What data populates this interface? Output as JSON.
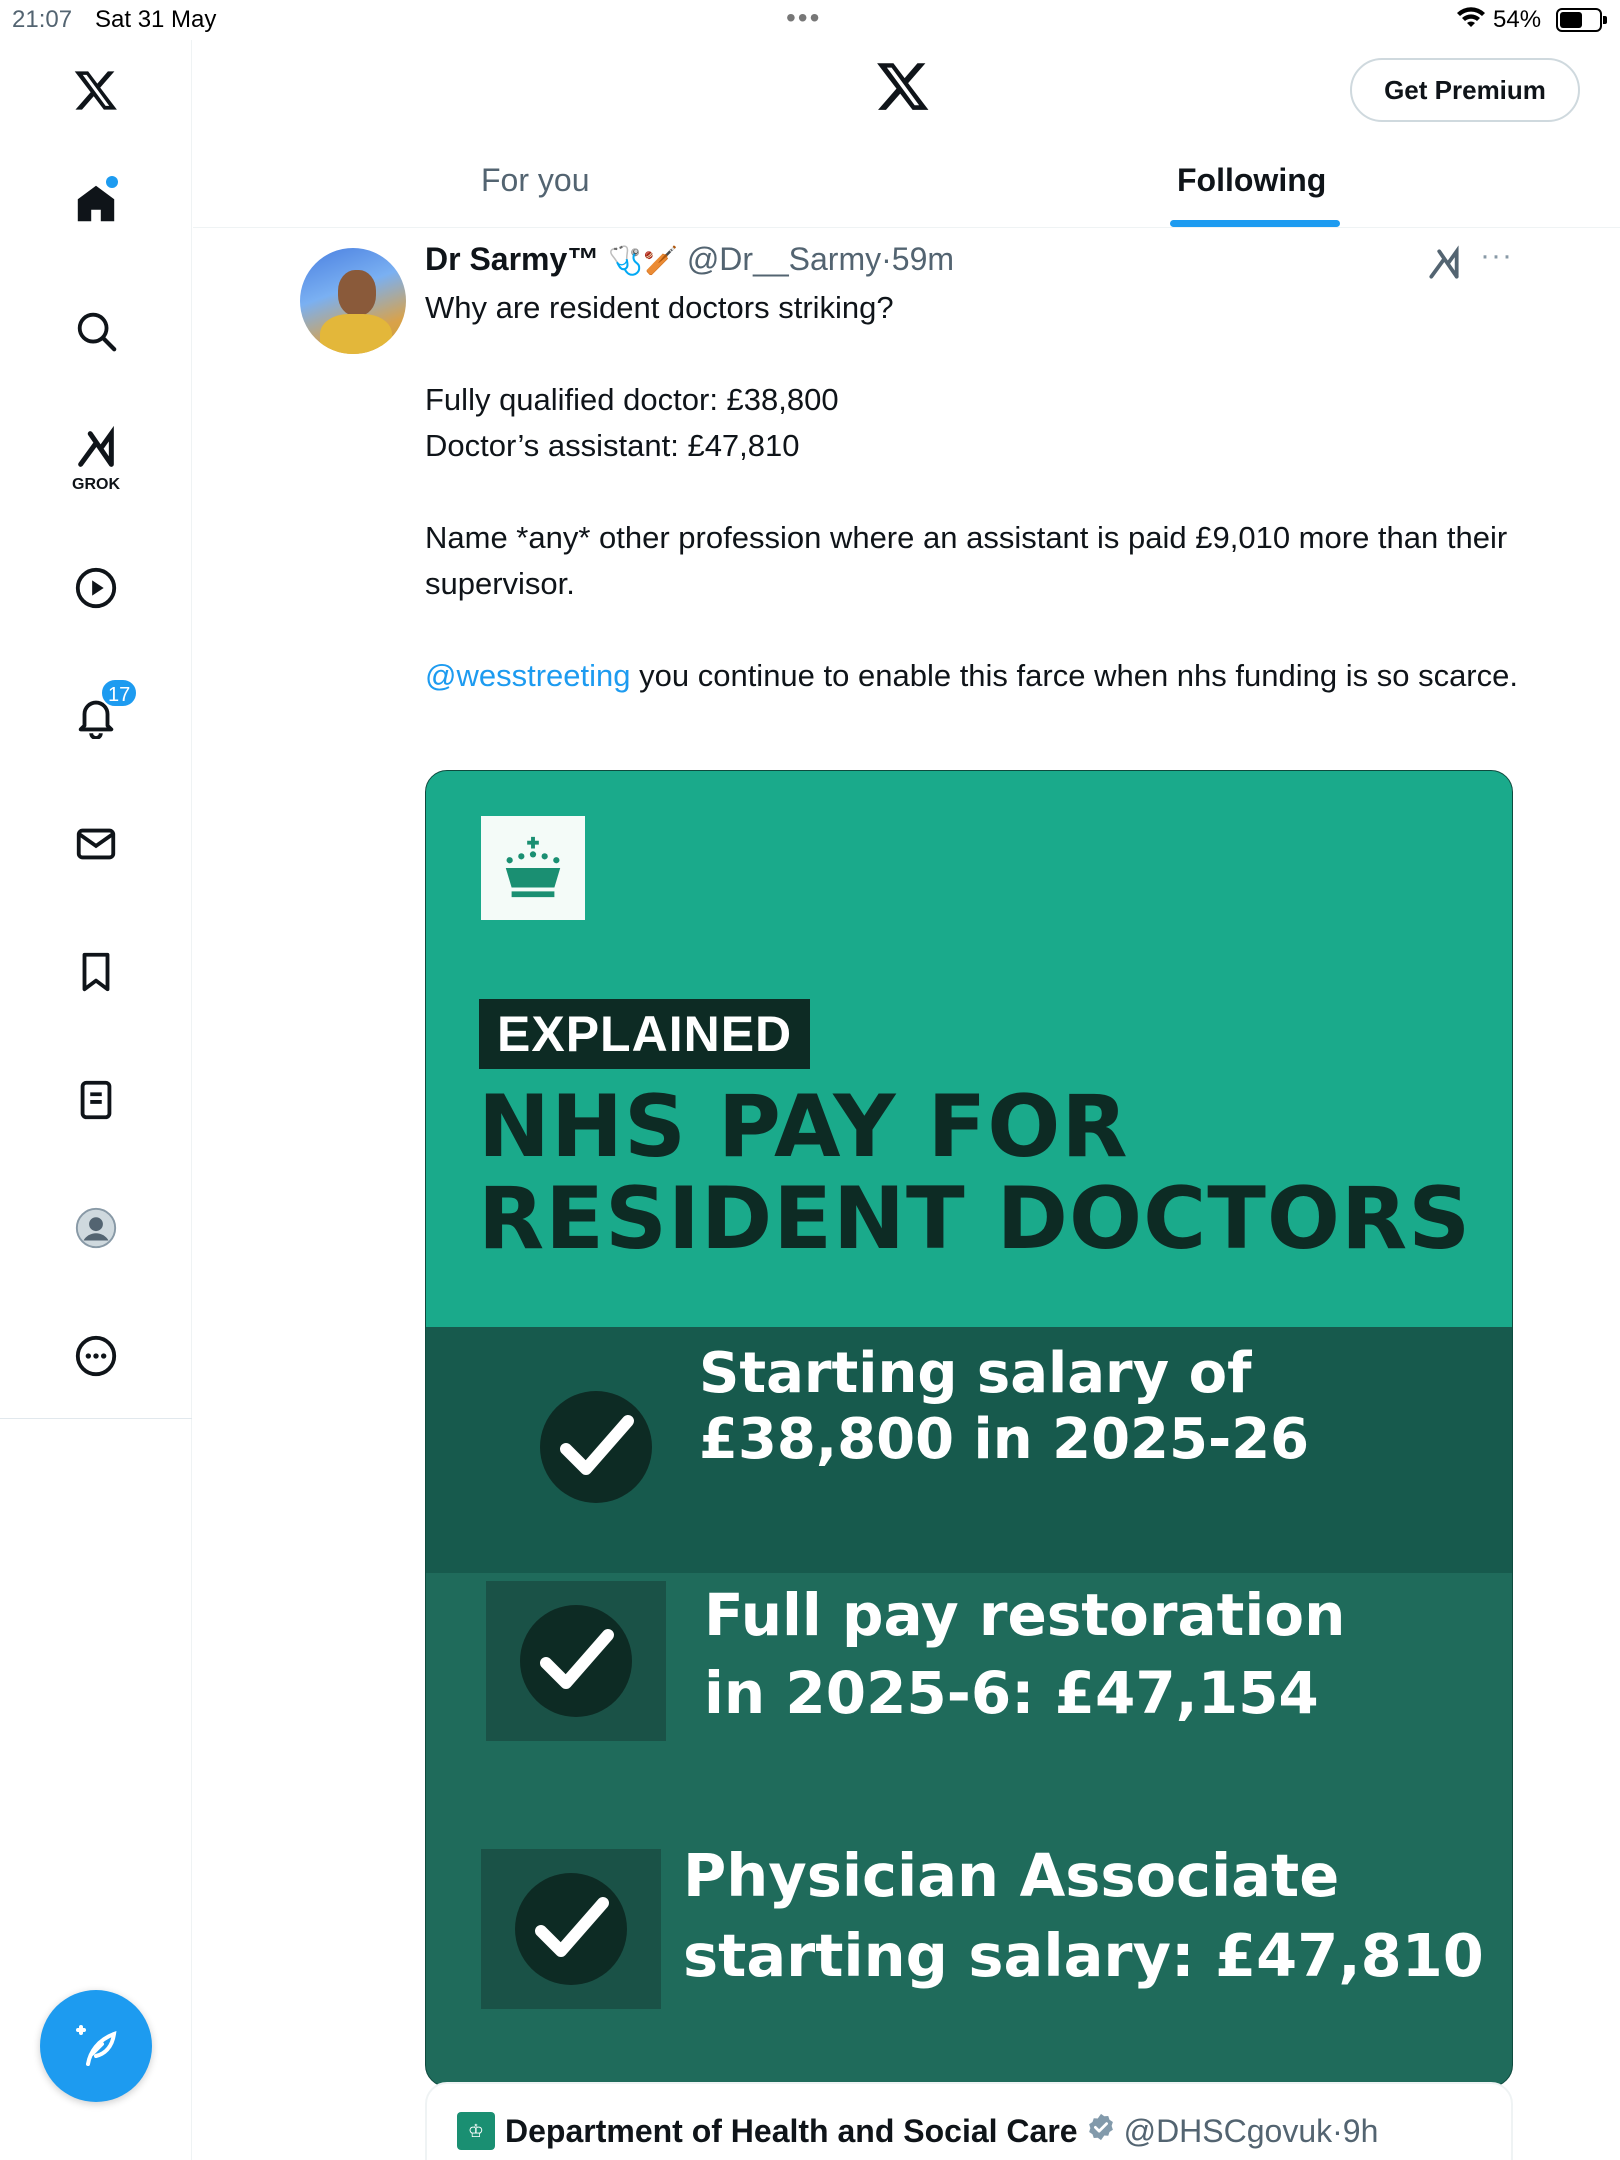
{
  "status_bar": {
    "time": "21:07",
    "date": "Sat 31 May",
    "battery": "54%",
    "dots": "•••"
  },
  "header": {
    "premium_label": "Get Premium",
    "tabs": [
      {
        "label": "For you",
        "active": false
      },
      {
        "label": "Following",
        "active": true
      }
    ]
  },
  "sidebar": {
    "items": [
      {
        "icon": "x-logo-icon"
      },
      {
        "icon": "home-icon",
        "has_dot": true
      },
      {
        "icon": "search-icon"
      },
      {
        "icon": "grok-icon",
        "label": "GROK"
      },
      {
        "icon": "video-icon"
      },
      {
        "icon": "notifications-icon",
        "badge": "17"
      },
      {
        "icon": "messages-icon"
      },
      {
        "icon": "bookmarks-icon"
      },
      {
        "icon": "lists-icon"
      },
      {
        "icon": "profile-icon"
      },
      {
        "icon": "more-icon"
      }
    ]
  },
  "tweet": {
    "author": "Dr Sarmy™",
    "author_emojis": "🩺🏏",
    "handle": "@Dr__Sarmy",
    "separator": "·",
    "time": "59m",
    "more": "···",
    "text": {
      "line1": "Why are resident doctors striking?",
      "line2": "Fully qualified doctor: £38,800",
      "line3": "Doctor’s assistant: £47,810",
      "line4": "Name *any* other profession where an assistant is paid £9,010 more than their supervisor.",
      "mention": "@wesstreeting",
      "line5_rest": " you continue to enable this farce when nhs funding is so scarce."
    },
    "media": {
      "tag": "EXPLAINED",
      "headline_1": "NHS PAY FOR",
      "headline_2": "RESIDENT DOCTORS",
      "point1_a": "Starting salary of",
      "point1_b": "£38,800 in 2025-26",
      "point2_a": "Full pay restoration",
      "point2_b": "in 2025-6: £47,154",
      "point3_a": "Physician Associate",
      "point3_b": "starting salary: £47,810",
      "colors": {
        "top": "#1aaa8b",
        "bottom": "#1f6b5b",
        "ink": "#0d2b24"
      }
    },
    "quoted": {
      "name": "Department of Health and Social Care",
      "handle": "@DHSCgovuk",
      "separator": "·",
      "time": "9h"
    }
  },
  "colors": {
    "accent": "#1d9bf0",
    "text": "#0f1419",
    "muted": "#536471"
  }
}
